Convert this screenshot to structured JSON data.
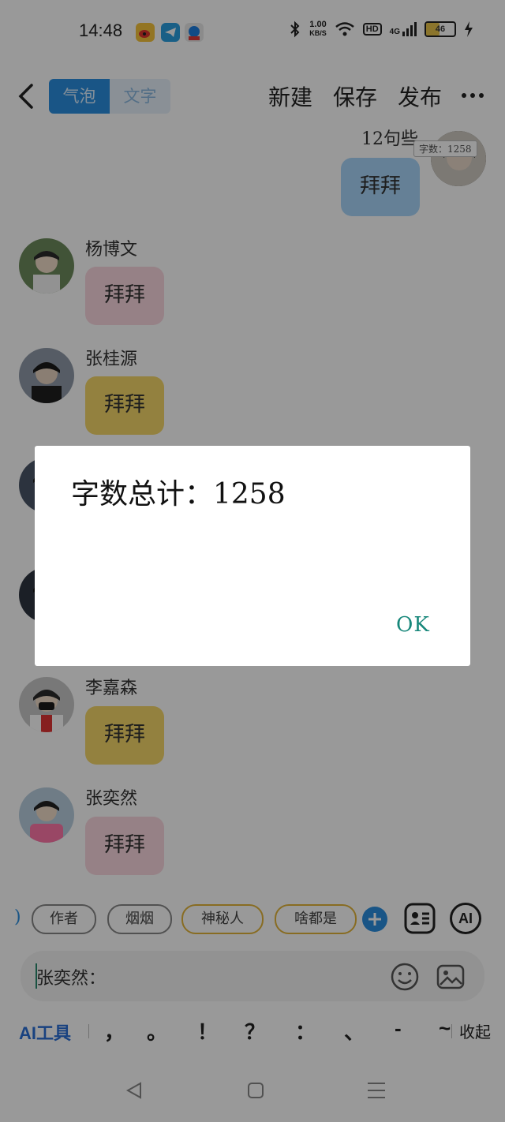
{
  "status_bar": {
    "time": "14:48",
    "net_speed_value": "1.00",
    "net_speed_unit": "KB/S",
    "hd": "HD",
    "signal": "4G",
    "battery": "46",
    "battery_level_percent": 46
  },
  "top_bar": {
    "tabs": [
      "气泡",
      "文字"
    ],
    "active_tab": "气泡",
    "actions": {
      "new": "新建",
      "save": "保存",
      "publish": "发布"
    }
  },
  "chat": {
    "partial_message_text": "12句些",
    "word_count_badge": "字数：1258",
    "messages": [
      {
        "side": "right",
        "text": "拜拜",
        "color": "blue"
      },
      {
        "side": "left",
        "name": "杨博文",
        "text": "拜拜",
        "color": "pink"
      },
      {
        "side": "left",
        "name": "张桂源",
        "text": "拜拜",
        "color": "yellow"
      },
      {
        "side": "left",
        "name": "李嘉森",
        "text": "拜拜",
        "color": "yellow"
      },
      {
        "side": "left",
        "name": "张奕然",
        "text": "拜拜",
        "color": "pink"
      }
    ]
  },
  "tags": [
    {
      "label": "作者",
      "style": "gray"
    },
    {
      "label": "烟烟",
      "style": "gray"
    },
    {
      "label": "神秘人",
      "style": "gold"
    },
    {
      "label": "啥都是",
      "style": "gold"
    }
  ],
  "ai_button": "AI",
  "input": {
    "value": "张奕然："
  },
  "quick_bar": {
    "ai_tools": "AI工具",
    "keys": [
      "，",
      "。",
      "！",
      "？",
      "：",
      "、",
      "-",
      "~"
    ],
    "collapse": "收起"
  },
  "dialog": {
    "message": "字数总计：1258",
    "ok": "OK"
  },
  "colors": {
    "accent_blue": "#2a8ee0",
    "bubble_pink": "#fbd7df",
    "bubble_yellow": "#f6d86a",
    "bubble_blue": "#a8d6fb",
    "ok_teal": "#17877a"
  }
}
